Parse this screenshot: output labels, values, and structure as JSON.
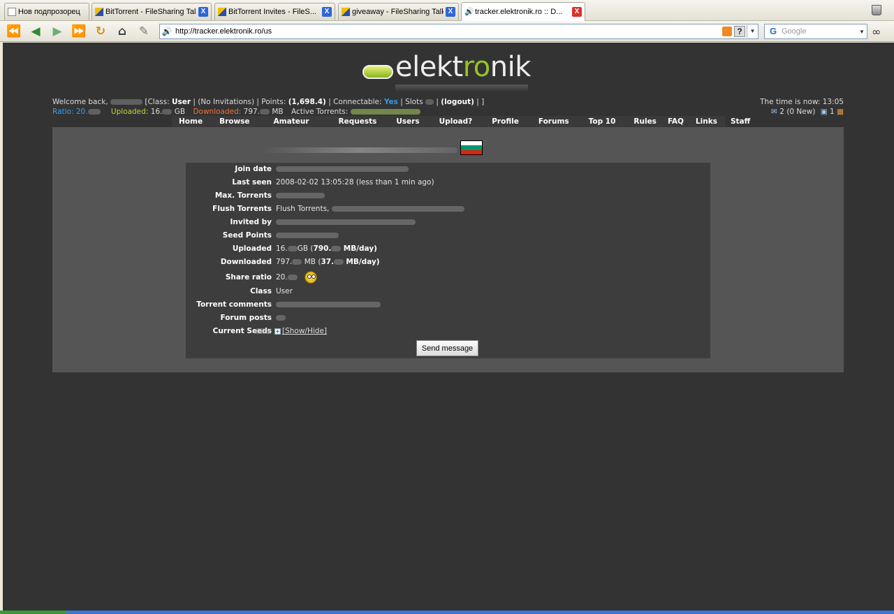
{
  "browser": {
    "tabs": [
      {
        "title": "Нов подпрозорец",
        "favicon": "page-icon"
      },
      {
        "title": "BitTorrent - FileSharing Talk",
        "favicon": "fst-icon"
      },
      {
        "title": "BitTorrent Invites - FileS...",
        "favicon": "fst-icon"
      },
      {
        "title": "giveaway - FileSharing Talk",
        "favicon": "fst-icon"
      },
      {
        "title": "tracker.elektronik.ro :: D...",
        "favicon": "speaker-icon"
      }
    ],
    "tab_close": "X",
    "address": "http://tracker.elektronik.ro/us",
    "search_placeholder": "Google",
    "search_engine_letter": "G",
    "help_glyph": "?",
    "rss_glyph": "RSS"
  },
  "site": {
    "logo_pre": "elekt",
    "logo_hl": "ro",
    "logo_post": "nik"
  },
  "userbar": {
    "welcome": "Welcome back,",
    "class_label": "[Class:",
    "class_value": "User",
    "invitations": "|  (No Invitations) |  Points:",
    "points": "(1,698.4)",
    "connectable_label": "| Connectable:",
    "connectable_value": "Yes",
    "slots_label": "|  Slots",
    "logout": "(logout)",
    "close_bracket": "|  ]",
    "ratio_label": "Ratio:",
    "ratio_value": "20.",
    "uploaded_label": "Uploaded:",
    "uploaded_value": "16.",
    "uploaded_unit": "GB",
    "downloaded_label": "Downloaded:",
    "downloaded_value": "797.",
    "downloaded_unit": "MB",
    "active_torrents": "Active Torrents:",
    "time": "The time is now: 13:05",
    "messages": "2 (0 New)",
    "friends": "1"
  },
  "menu": [
    "Home",
    "Browse",
    "Amateur",
    "Requests",
    "Users",
    "Upload?",
    "Profile",
    "Forums",
    "Top 10",
    "Rules",
    "FAQ",
    "Links",
    "Staff"
  ],
  "colors": {
    "flag": [
      "#ffffff",
      "#00966e",
      "#d62612"
    ]
  },
  "profile": {
    "rows": [
      {
        "label": "Join date",
        "value": ""
      },
      {
        "label": "Last seen",
        "value": "2008-02-02 13:05:28 (less than 1 min ago)"
      },
      {
        "label": "Max. Torrents",
        "value": ""
      },
      {
        "label": "Flush Torrents",
        "value": "Flush Torrents,"
      },
      {
        "label": "Invited by",
        "value": ""
      },
      {
        "label": "Seed Points",
        "value": ""
      },
      {
        "label": "Uploaded",
        "value_a": "16.",
        "value_b": "GB (",
        "value_c": "790.",
        "value_d": "MB/day)"
      },
      {
        "label": "Downloaded",
        "value_a": "797.",
        "value_b": "MB (",
        "value_c": "37.",
        "value_d": "MB/day)"
      },
      {
        "label": "Share ratio",
        "value": "20."
      },
      {
        "label": "Class",
        "value": "User"
      },
      {
        "label": "Torrent comments",
        "value": ""
      },
      {
        "label": "Forum posts",
        "value": ""
      },
      {
        "label": "Current Seeds",
        "value": "",
        "toggle": "[Show/Hide]",
        "toggle_glyph": "+"
      }
    ],
    "send_message": "Send message"
  }
}
